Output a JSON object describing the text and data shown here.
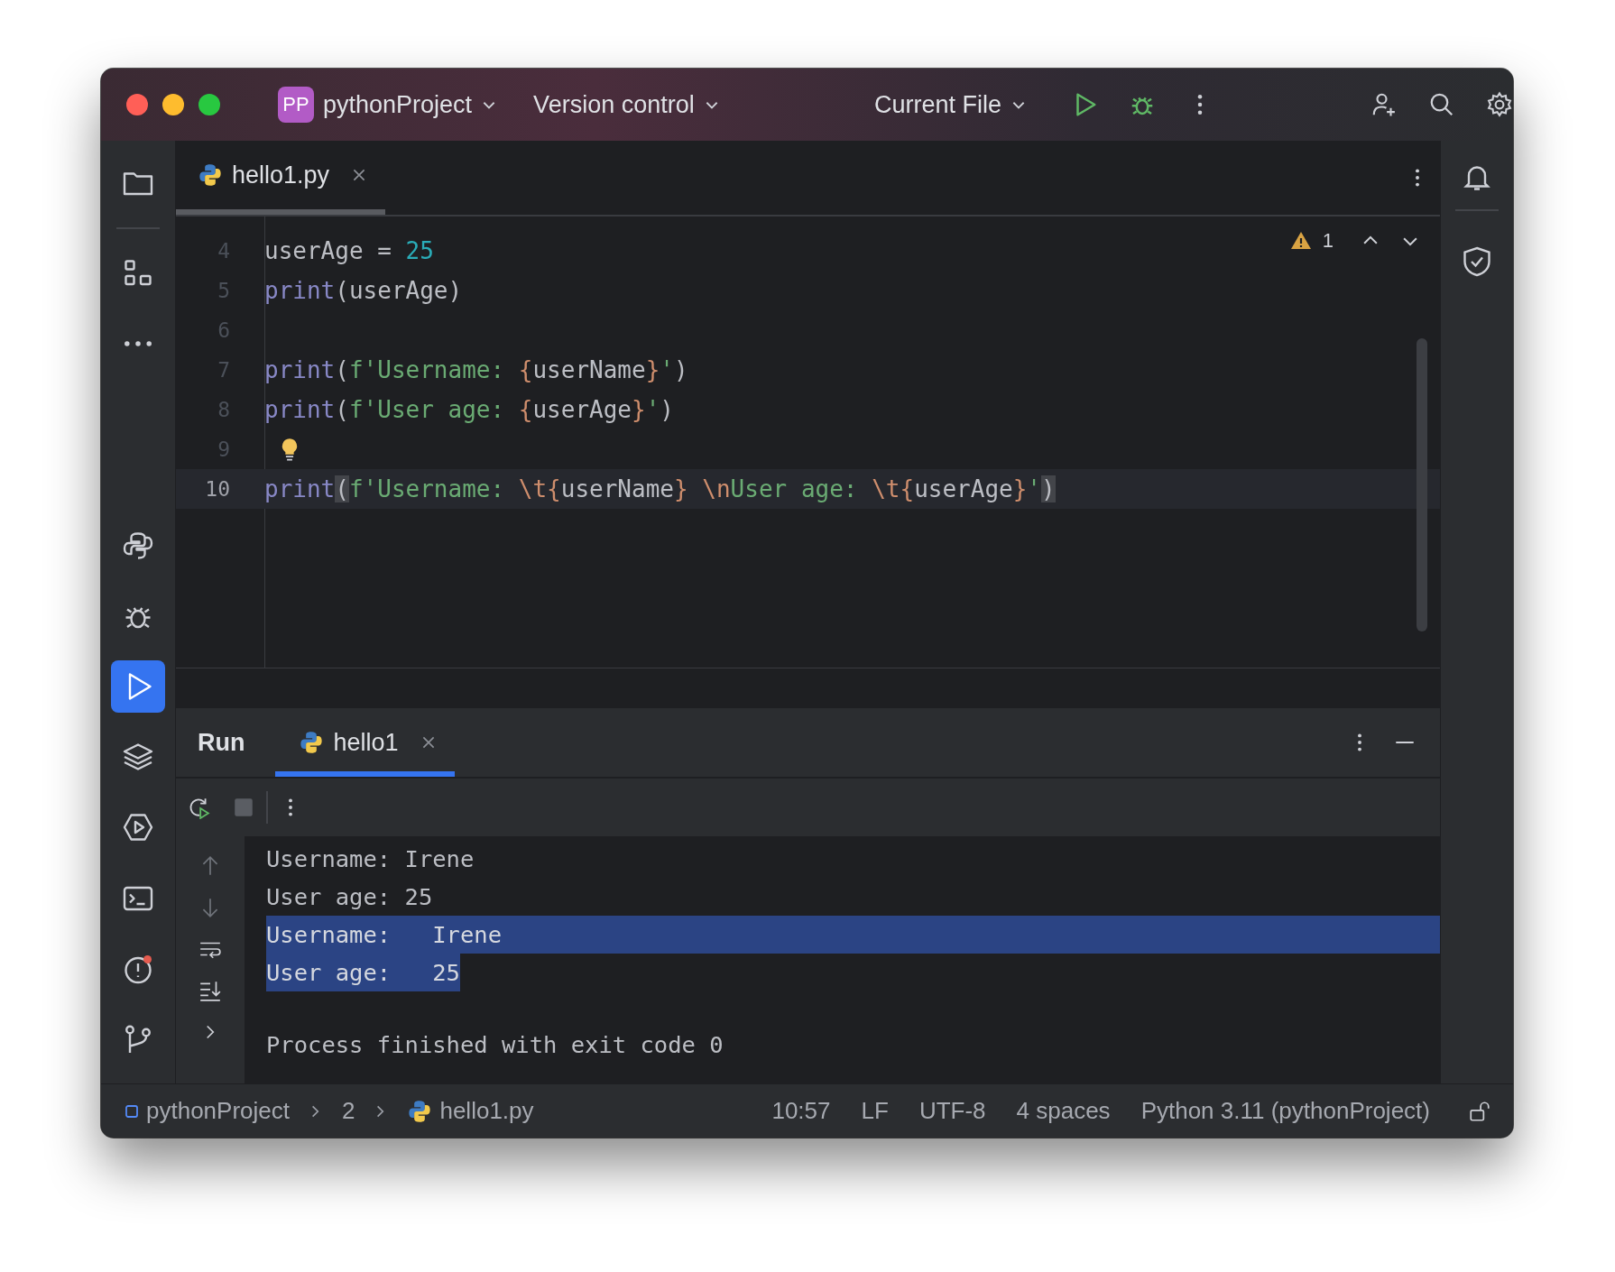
{
  "title_bar": {
    "project_badge": "PP",
    "project": "pythonProject",
    "vcs": "Version control",
    "run_config": "Current File"
  },
  "left_toolbar": [
    {
      "selected": false
    },
    {
      "selected": false
    },
    {
      "selected": false
    },
    {
      "selected": false
    },
    {
      "selected": false
    },
    {
      "selected": true
    },
    {
      "selected": false
    },
    {
      "selected": false
    },
    {
      "selected": false
    },
    {
      "selected": false
    },
    {
      "selected": false
    }
  ],
  "editor_tabs": [
    {
      "label": "hello1.py",
      "selected": true
    }
  ],
  "inspections": {
    "warnings": "1"
  },
  "code_lines": [
    {
      "number": "4",
      "current": false,
      "tokens": [
        {
          "text": "userAge = ",
          "kind": "plain"
        },
        {
          "text": "25",
          "kind": "number"
        }
      ]
    },
    {
      "number": "5",
      "current": false,
      "tokens": [
        {
          "text": "print",
          "kind": "builtin"
        },
        {
          "text": "(userAge)",
          "kind": "plain"
        }
      ]
    },
    {
      "number": "6",
      "current": false
    },
    {
      "number": "7",
      "current": false,
      "tokens": [
        {
          "text": "print",
          "kind": "builtin"
        },
        {
          "text": "(",
          "kind": "plain"
        },
        {
          "text": "f'Username: ",
          "kind": "string"
        },
        {
          "text": "{",
          "kind": "brace"
        },
        {
          "text": "userName",
          "kind": "plain"
        },
        {
          "text": "}",
          "kind": "brace"
        },
        {
          "text": "'",
          "kind": "string"
        },
        {
          "text": ")",
          "kind": "plain"
        }
      ]
    },
    {
      "number": "8",
      "current": false,
      "tokens": [
        {
          "text": "print",
          "kind": "builtin"
        },
        {
          "text": "(",
          "kind": "plain"
        },
        {
          "text": "f'User age: ",
          "kind": "string"
        },
        {
          "text": "{",
          "kind": "brace"
        },
        {
          "text": "userAge",
          "kind": "plain"
        },
        {
          "text": "}",
          "kind": "brace"
        },
        {
          "text": "'",
          "kind": "string"
        },
        {
          "text": ")",
          "kind": "plain"
        }
      ]
    },
    {
      "number": "9",
      "current": false,
      "hint": true
    },
    {
      "number": "10",
      "current": true,
      "tokens": [
        {
          "text": "print",
          "kind": "builtin"
        },
        {
          "text": "(",
          "kind": "paren-match"
        },
        {
          "text": "f'Username: ",
          "kind": "string"
        },
        {
          "text": "\\t{",
          "kind": "brace"
        },
        {
          "text": "userName",
          "kind": "plain"
        },
        {
          "text": "} ",
          "kind": "brace"
        },
        {
          "text": "\\n",
          "kind": "brace"
        },
        {
          "text": "User age: ",
          "kind": "string"
        },
        {
          "text": "\\t{",
          "kind": "brace"
        },
        {
          "text": "userAge",
          "kind": "plain"
        },
        {
          "text": "}",
          "kind": "brace"
        },
        {
          "text": "'",
          "kind": "string"
        },
        {
          "text": ")",
          "kind": "paren-match"
        }
      ]
    }
  ],
  "run_panel": {
    "title": "Run",
    "tabs": [
      {
        "label": "hello1",
        "selected": true
      }
    ],
    "console": [
      {
        "text": "Username: Irene",
        "selected": false
      },
      {
        "text": "User age: 25",
        "selected": false
      },
      {
        "text": "Username:   Irene",
        "selected": true
      },
      {
        "text": "User age:   25",
        "selected": true
      },
      {
        "text": "Process finished with exit code 0",
        "selected": false,
        "gap_before": true
      }
    ]
  },
  "status_bar": {
    "breadcrumbs": [
      "pythonProject",
      "2",
      "hello1.py"
    ],
    "items": [
      "10:57",
      "LF",
      "UTF-8",
      "4 spaces",
      "Python 3.11 (pythonProject)"
    ]
  }
}
